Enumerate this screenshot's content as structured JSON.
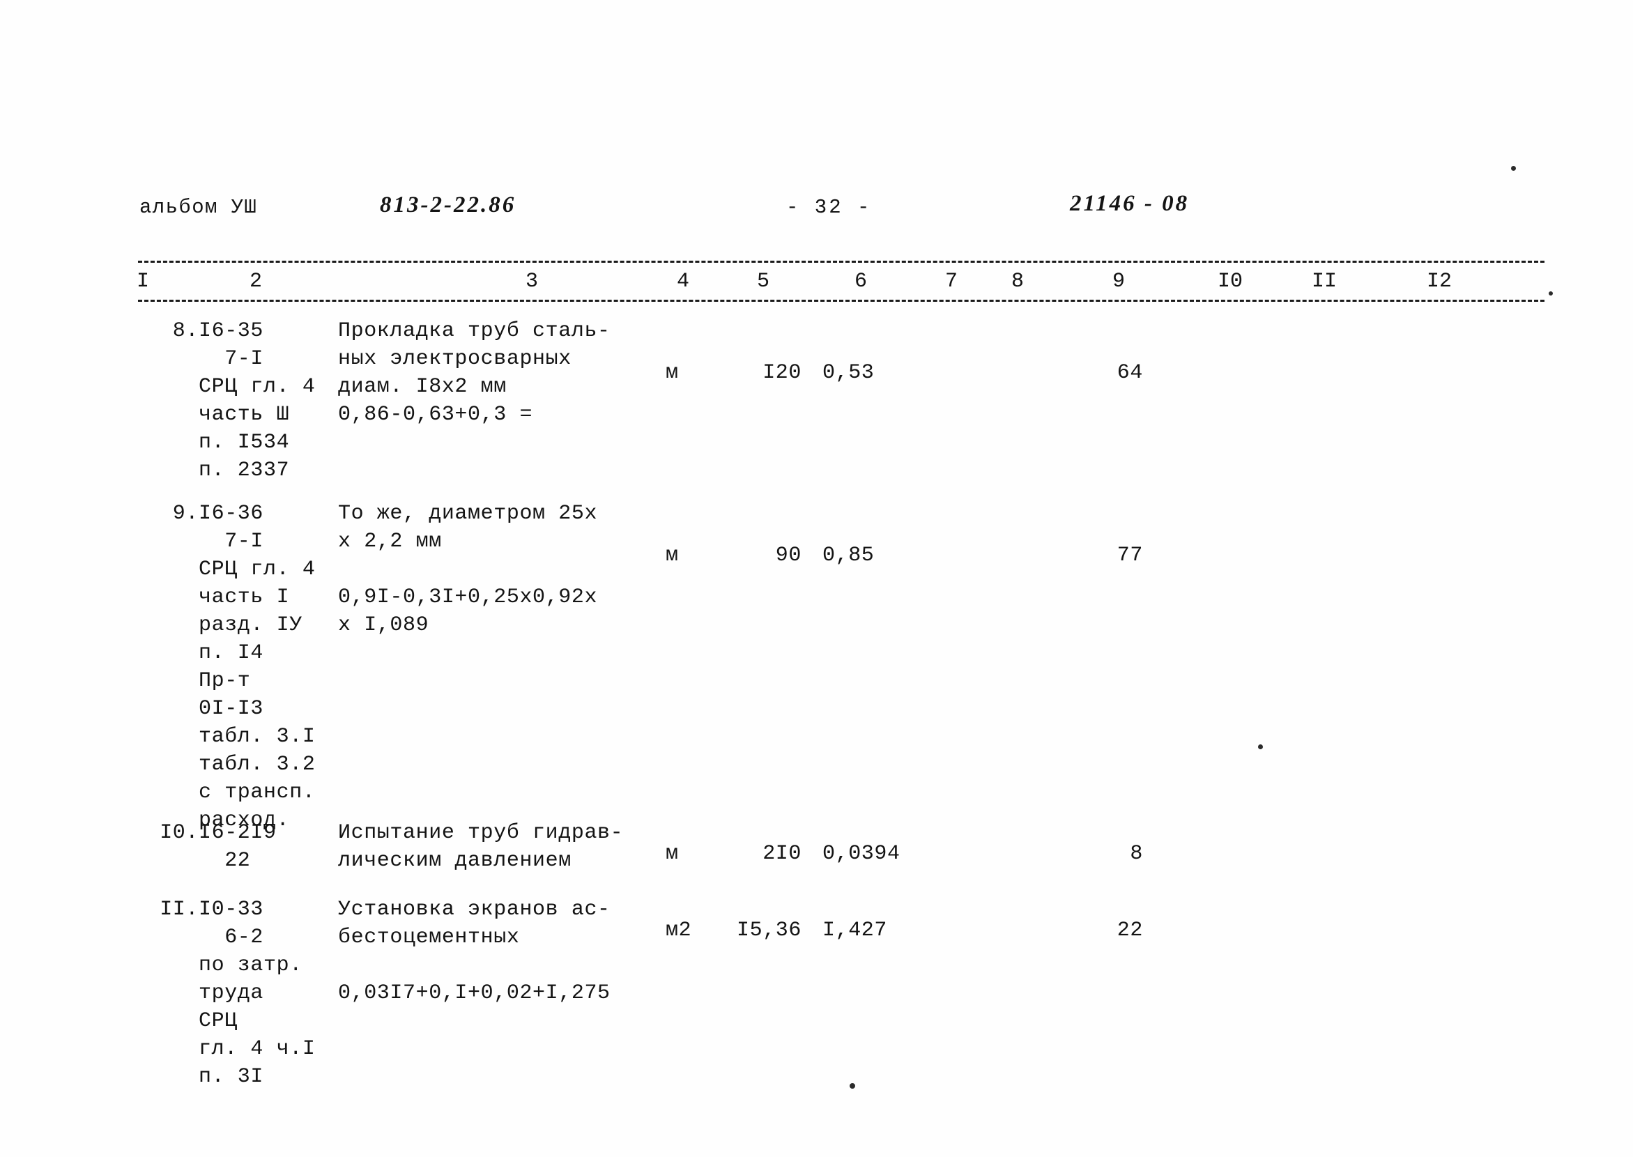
{
  "header": {
    "album_label": "альбом УШ",
    "doc_code": "813-2-22.86",
    "page_number": "- 32 -",
    "archive_code": "21146 - 08"
  },
  "table": {
    "column_numbers": [
      "I",
      "2",
      "3",
      "4",
      "5",
      "6",
      "7",
      "8",
      "9",
      "I0",
      "II",
      "I2"
    ],
    "rows": [
      {
        "no": "8.",
        "code": "I6-35\n  7-I\nСРЦ гл. 4\nчасть Ш\nп. I534\nп. 2337",
        "desc": "Прокладка труб сталь-\nных электросварных\nдиам. I8х2 мм",
        "formula": "0,86-0,63+0,3 =",
        "unit": "м",
        "qty": "I20",
        "price": "0,53",
        "total": "64"
      },
      {
        "no": "9.",
        "code": "I6-36\n  7-I\nСРЦ гл. 4\nчасть I\nразд. IУ\nп. I4\nПр-т\n0I-I3\nтабл. 3.I\nтабл. 3.2\nс трансп.\nрасход.",
        "desc": "То же, диаметром 25х\nх 2,2 мм",
        "formula": "0,9I-0,3I+0,25х0,92х\nх I,089",
        "unit": "м",
        "qty": "90",
        "price": "0,85",
        "total": "77"
      },
      {
        "no": "I0.",
        "code": "I6-2I9\n  22",
        "desc": "Испытание труб гидрав-\nлическим давлением",
        "formula": "",
        "unit": "м",
        "qty": "2I0",
        "price": "0,0394",
        "total": "8"
      },
      {
        "no": "II.",
        "code": "I0-33\n  6-2\nпо затр.\nтруда\nСРЦ\nгл. 4 ч.I\nп. 3I",
        "desc": "Установка экранов ас-\nбестоцементных",
        "formula": "0,03I7+0,I+0,02+I,275",
        "unit": "м2",
        "qty": "I5,36",
        "price": "I,427",
        "total": "22"
      }
    ]
  }
}
